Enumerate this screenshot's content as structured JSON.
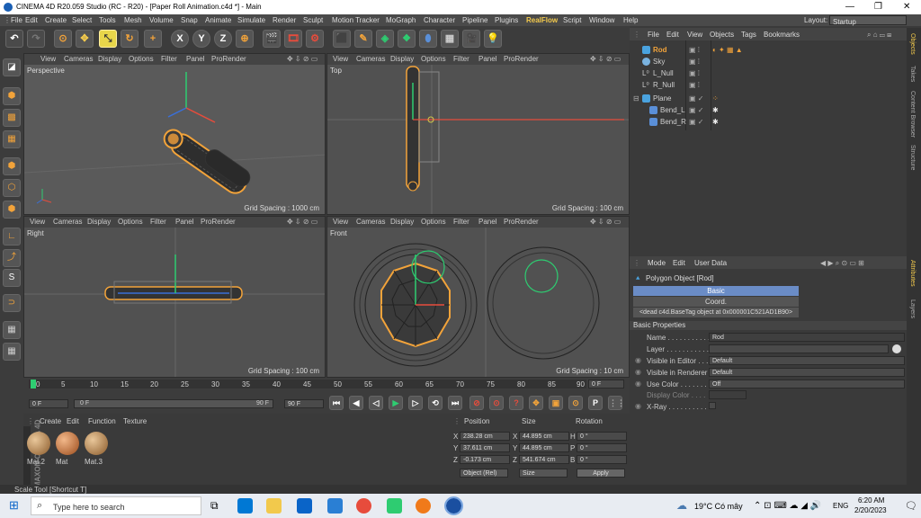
{
  "titlebar": {
    "title": "CINEMA 4D R20.059 Studio (RC - R20) - [Paper Roll Animation.c4d *] - Main"
  },
  "menu": [
    "File",
    "Edit",
    "Create",
    "Select",
    "Tools",
    "Mesh",
    "Volume",
    "Snap",
    "Animate",
    "Simulate",
    "Render",
    "Sculpt",
    "Motion Tracker",
    "MoGraph",
    "Character",
    "Pipeline",
    "Plugins",
    "RealFlow",
    "Script",
    "Window",
    "Help"
  ],
  "layout": {
    "label": "Layout:",
    "value": "Startup"
  },
  "toolbar": {
    "x": "X",
    "y": "Y",
    "z": "Z"
  },
  "viewport_menu": [
    "View",
    "Cameras",
    "Display",
    "Options",
    "Filter",
    "Panel",
    "ProRender"
  ],
  "viewports": {
    "perspective": {
      "name": "Perspective",
      "grid": "Grid Spacing : 1000 cm"
    },
    "top": {
      "name": "Top",
      "grid": "Grid Spacing : 100 cm"
    },
    "right": {
      "name": "Right",
      "grid": "Grid Spacing : 100 cm"
    },
    "front": {
      "name": "Front",
      "grid": "Grid Spacing : 10 cm"
    }
  },
  "object_menu": [
    "File",
    "Edit",
    "View",
    "Objects",
    "Tags",
    "Bookmarks"
  ],
  "objects": [
    {
      "name": "Rod",
      "color": "#f2a33a"
    },
    {
      "name": "Sky",
      "color": "#cccccc"
    },
    {
      "name": "L_Null",
      "color": "#cccccc"
    },
    {
      "name": "R_Null",
      "color": "#cccccc"
    },
    {
      "name": "Plane",
      "color": "#cccccc"
    },
    {
      "name": "Bend_L",
      "color": "#cccccc"
    },
    {
      "name": "Bend_R",
      "color": "#cccccc"
    }
  ],
  "attr_menu": [
    "Mode",
    "Edit",
    "User Data"
  ],
  "attributes": {
    "object_title": "Polygon Object [Rod]",
    "tab_basic": "Basic",
    "tab_coord": "Coord.",
    "dead_tag": "<dead c4d.BaseTag object at 0x000001C521AD1B90>",
    "section": "Basic Properties",
    "fields": [
      {
        "label": "Name . . . . . . . . . . . .",
        "value": "Rod"
      },
      {
        "label": "Layer . . . . . . . . . . . .",
        "value": ""
      },
      {
        "label": "Visible in Editor . . .",
        "value": "Default"
      },
      {
        "label": "Visible in Renderer",
        "value": "Default"
      },
      {
        "label": "Use Color . . . . . . .",
        "value": "Off"
      },
      {
        "label": "Display Color . . . .",
        "value": ""
      },
      {
        "label": "X-Ray . . . . . . . . . . .",
        "value": ""
      }
    ]
  },
  "right_tabs": [
    "Objects",
    "Takes",
    "Content Browser",
    "Structure",
    "Attributes",
    "Layers"
  ],
  "timeline": {
    "ticks": [
      "0",
      "5",
      "10",
      "15",
      "20",
      "25",
      "30",
      "35",
      "40",
      "45",
      "50",
      "55",
      "60",
      "65",
      "70",
      "75",
      "80",
      "85",
      "90"
    ],
    "current": "0 F",
    "start": "0 F",
    "start2": "0 F",
    "end": "90 F",
    "end2": "90 F"
  },
  "materials": {
    "menu": [
      "Create",
      "Edit",
      "Function",
      "Texture"
    ],
    "items": [
      "Mat.2",
      "Mat",
      "Mat.3"
    ]
  },
  "coords": {
    "headers": [
      "Position",
      "Size",
      "Rotation"
    ],
    "rows": [
      {
        "axis": "X",
        "pos": "238.28 cm",
        "size_axis": "X",
        "size": "44.895 cm",
        "rot_axis": "H",
        "rot": "0 °"
      },
      {
        "axis": "Y",
        "pos": "37.611 cm",
        "size_axis": "Y",
        "size": "44.895 cm",
        "rot_axis": "P",
        "rot": "0 °"
      },
      {
        "axis": "Z",
        "pos": "-0.173 cm",
        "size_axis": "Z",
        "size": "541.674 cm",
        "rot_axis": "B",
        "rot": "0 °"
      }
    ],
    "mode": "Object (Rel)",
    "size_mode": "Size",
    "apply": "Apply"
  },
  "brand": "MAXON CINEMA 4D",
  "status": "Scale Tool [Shortcut T]",
  "taskbar": {
    "search": "Type here to search",
    "weather": "19°C Có mây",
    "lang": "ENG",
    "time": "6:20 AM",
    "date": "2/20/2023"
  }
}
